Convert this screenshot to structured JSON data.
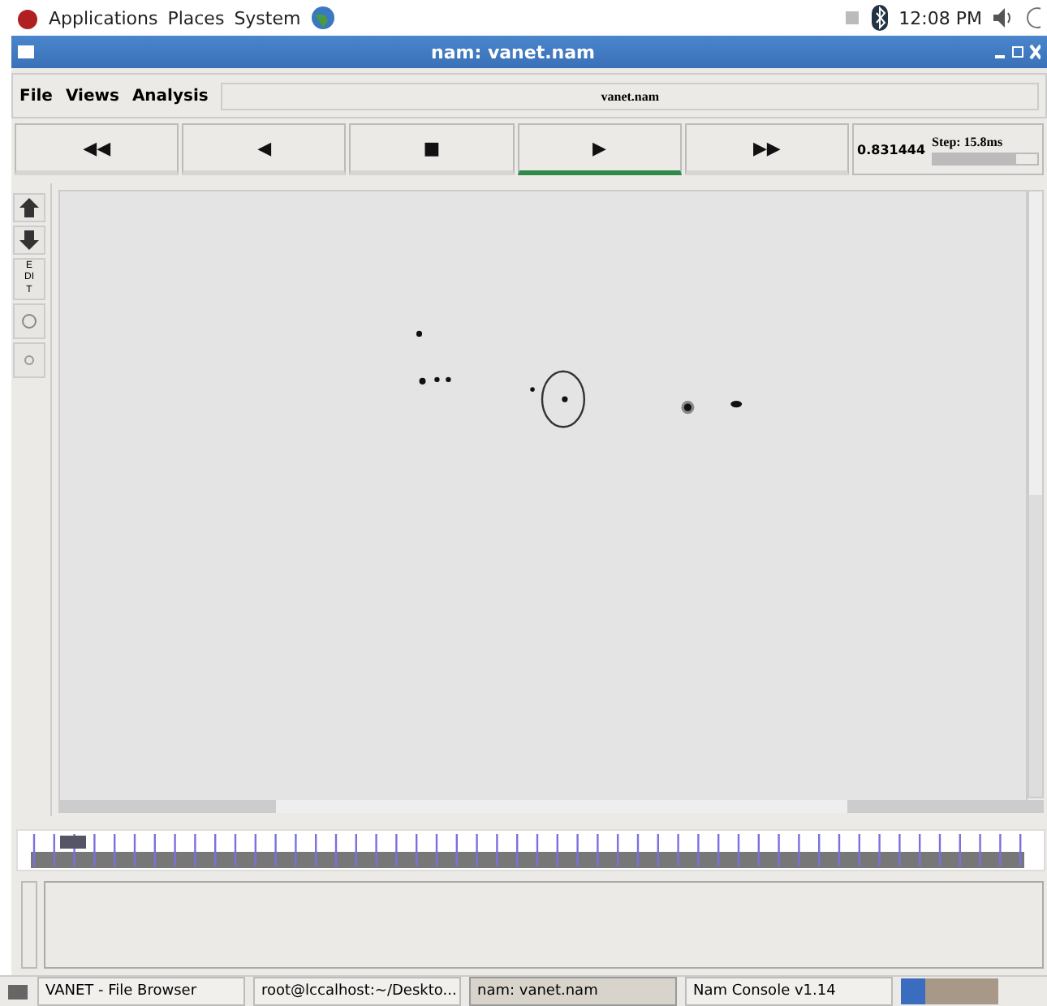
{
  "top_panel": {
    "menus": [
      "Applications",
      "Places",
      "System"
    ],
    "clock": "12:08 PM"
  },
  "window": {
    "title": "nam: vanet.nam"
  },
  "menubar": [
    "File",
    "Views",
    "Analysis"
  ],
  "file_name": "vanet.nam",
  "controls": [
    {
      "glyph": "◀◀",
      "selected": false
    },
    {
      "glyph": "◀",
      "selected": false
    },
    {
      "glyph": "■",
      "selected": false
    },
    {
      "glyph": "▶",
      "selected": true
    },
    {
      "glyph": "▶▶",
      "selected": false
    }
  ],
  "time": "0.831444",
  "step": {
    "label": "Step: 15.8ms",
    "level": 0.8
  },
  "tools": [
    {
      "kind": "zoom-in"
    },
    {
      "kind": "zoom-out"
    },
    {
      "kind": "text",
      "label": "EDIT"
    },
    {
      "kind": "circle"
    },
    {
      "kind": "dot"
    }
  ],
  "taskbar": [
    {
      "label": "VANET - File Browser",
      "selected": false
    },
    {
      "label": "root@lccalhost:~/Deskto...",
      "selected": false
    },
    {
      "label": "nam: vanet.nam",
      "selected": true
    },
    {
      "label": "Nam Console v1.14",
      "selected": false
    }
  ]
}
